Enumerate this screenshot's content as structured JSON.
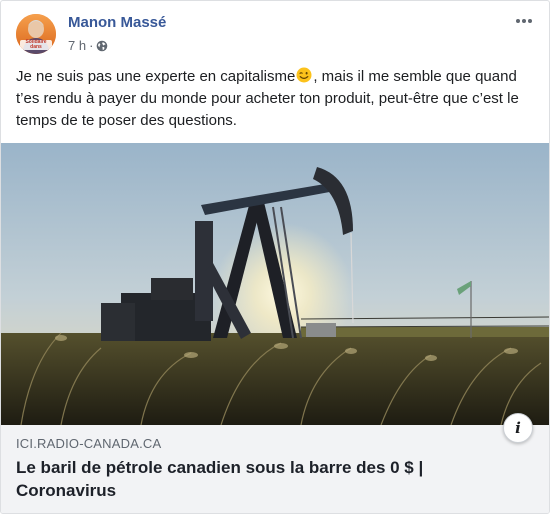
{
  "post": {
    "author": "Manon Massé",
    "time": "7 h",
    "separator": "·",
    "privacy_icon": "globe-icon",
    "text_before_emoji": "Je ne suis pas une experte en capitalisme",
    "emoji": "winking-face-emoji",
    "text_after_emoji": ", mais il me semble que quand t’es rendu à payer du monde pour acheter ton produit, peut-être que c’est le temps de te poser des questions."
  },
  "avatar": {
    "caption_line1": "Solidaire",
    "caption_line2": "dans",
    "caption_line3": "Sainte-Marie"
  },
  "link": {
    "domain": "ICI.RADIO-CANADA.CA",
    "title": "Le baril de pétrole canadien sous la barre des 0 $ | Coronavirus",
    "info_label": "i",
    "image_subject": "oil-pumpjack-silhouette-at-sunset"
  },
  "colors": {
    "author": "#385898",
    "meta": "#616770",
    "footer_bg": "#f2f3f5"
  }
}
